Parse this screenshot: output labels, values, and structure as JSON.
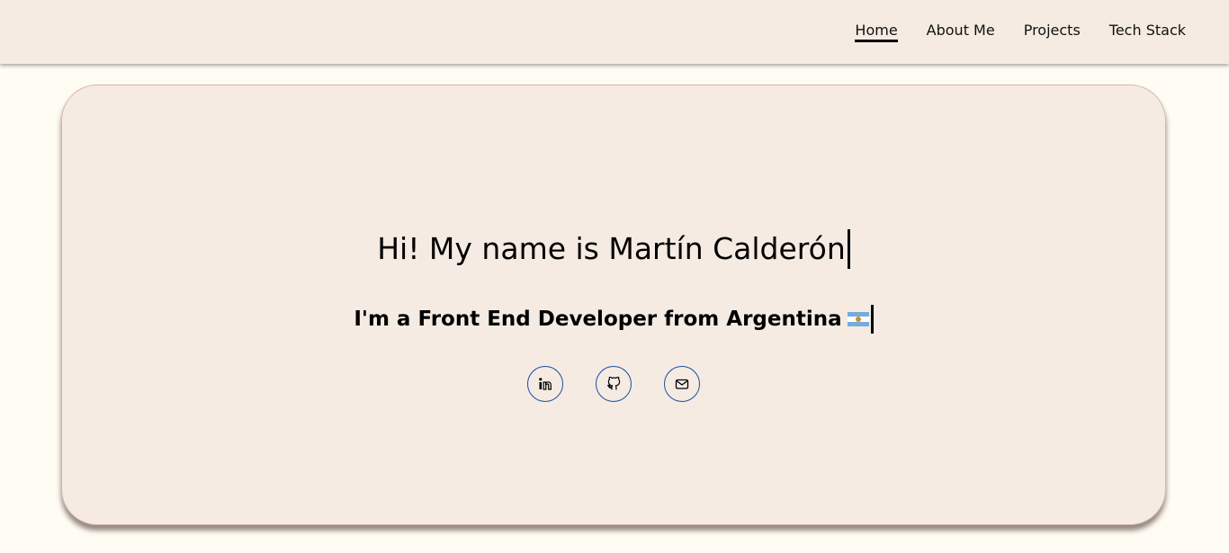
{
  "nav": {
    "items": [
      {
        "label": "Home",
        "active": true
      },
      {
        "label": "About Me",
        "active": false
      },
      {
        "label": "Projects",
        "active": false
      },
      {
        "label": "Tech Stack",
        "active": false
      }
    ]
  },
  "hero": {
    "title": "Hi! My name is Martín Calderón",
    "subtitle": "I'm a Front End Developer from Argentina",
    "flag_icon": "argentina-flag-icon"
  },
  "social": {
    "items": [
      {
        "icon": "linkedin-icon"
      },
      {
        "icon": "github-icon"
      },
      {
        "icon": "mail-icon"
      }
    ]
  },
  "colors": {
    "page_background": "#fffcf4",
    "card_background": "#f5ebe2",
    "icon_border": "#1a4fa0"
  }
}
